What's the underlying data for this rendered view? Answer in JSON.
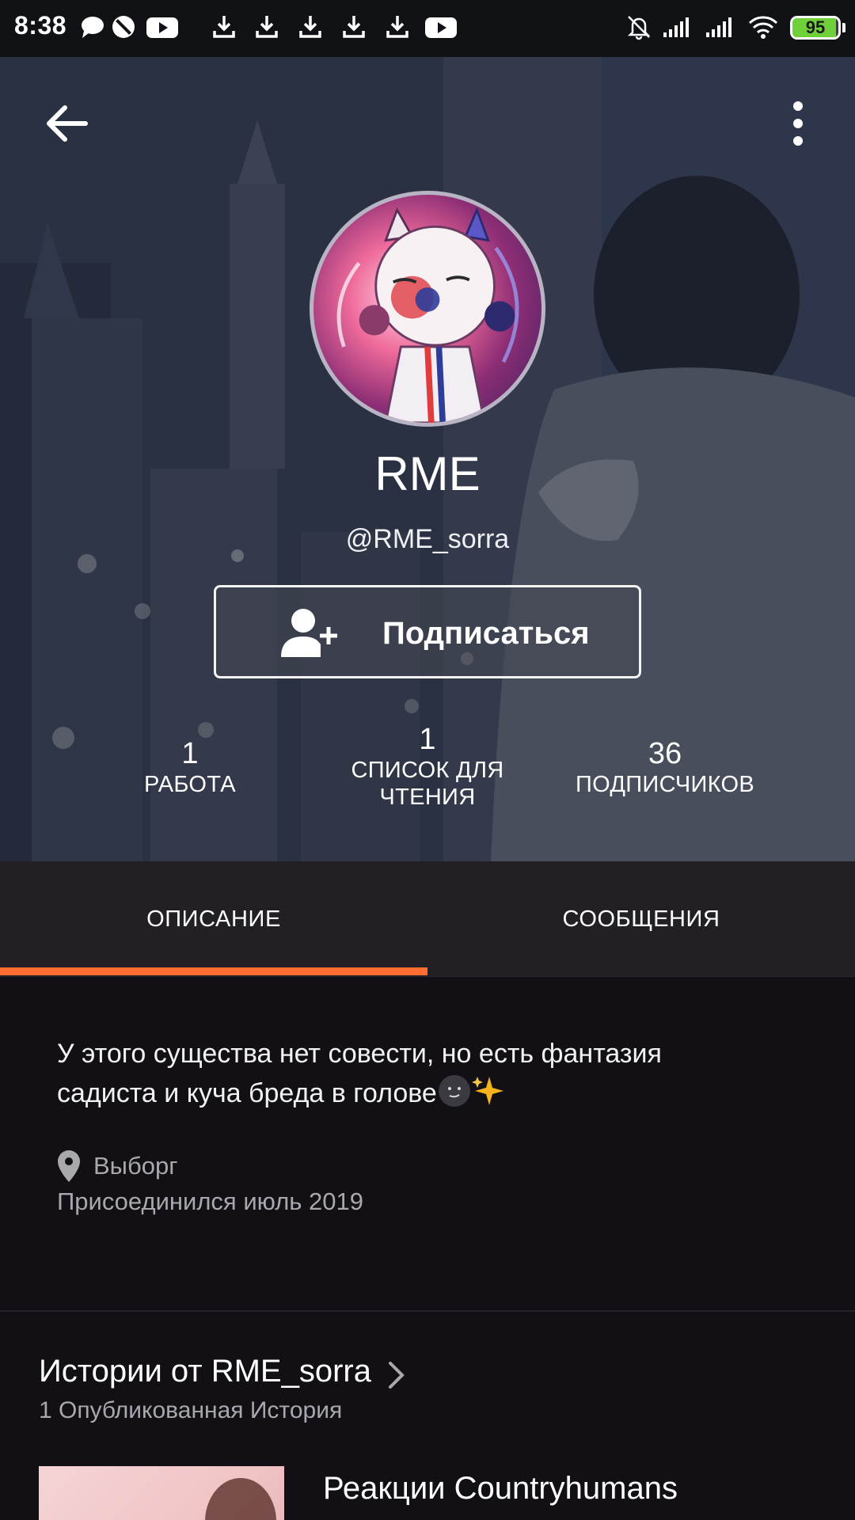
{
  "status_bar": {
    "time": "8:38",
    "battery": "95",
    "battery_fraction": 0.95,
    "left_icons": [
      "message-icon",
      "blocked-icon",
      "youtube-icon",
      "download-icon",
      "download-icon",
      "download-icon",
      "download-icon",
      "download-icon",
      "youtube-icon"
    ],
    "right_icons": [
      "bell-off-icon",
      "signal-icon",
      "signal-icon",
      "wifi-icon",
      "battery-icon"
    ]
  },
  "header": {
    "display_name": "RME",
    "username": "@RME_sorra",
    "follow_label": "Подписаться"
  },
  "stats": [
    {
      "value": "1",
      "label": "РАБОТА"
    },
    {
      "value": "1",
      "label": "СПИСОК ДЛЯ ЧТЕНИЯ"
    },
    {
      "value": "36",
      "label": "ПОДПИСЧИКОВ"
    }
  ],
  "tabs": [
    {
      "label": "ОПИСАНИЕ",
      "active": true
    },
    {
      "label": "СООБЩЕНИЯ",
      "active": false
    }
  ],
  "about": {
    "bio_line1": "У этого существа нет совести, но есть фантазия",
    "bio_line2": "садиста и куча бреда в голове",
    "location": "Выборг",
    "joined": "Присоединился июль 2019"
  },
  "stories": {
    "title": "Истории от RME_sorra",
    "count": "1 Опубликованная История",
    "items": [
      {
        "title": "Реакции Countryhumans"
      }
    ]
  },
  "colors": {
    "accent": "#ff6d33",
    "background": "#121015",
    "tab_bar": "#222024",
    "secondary_text": "#a9a8ad"
  }
}
